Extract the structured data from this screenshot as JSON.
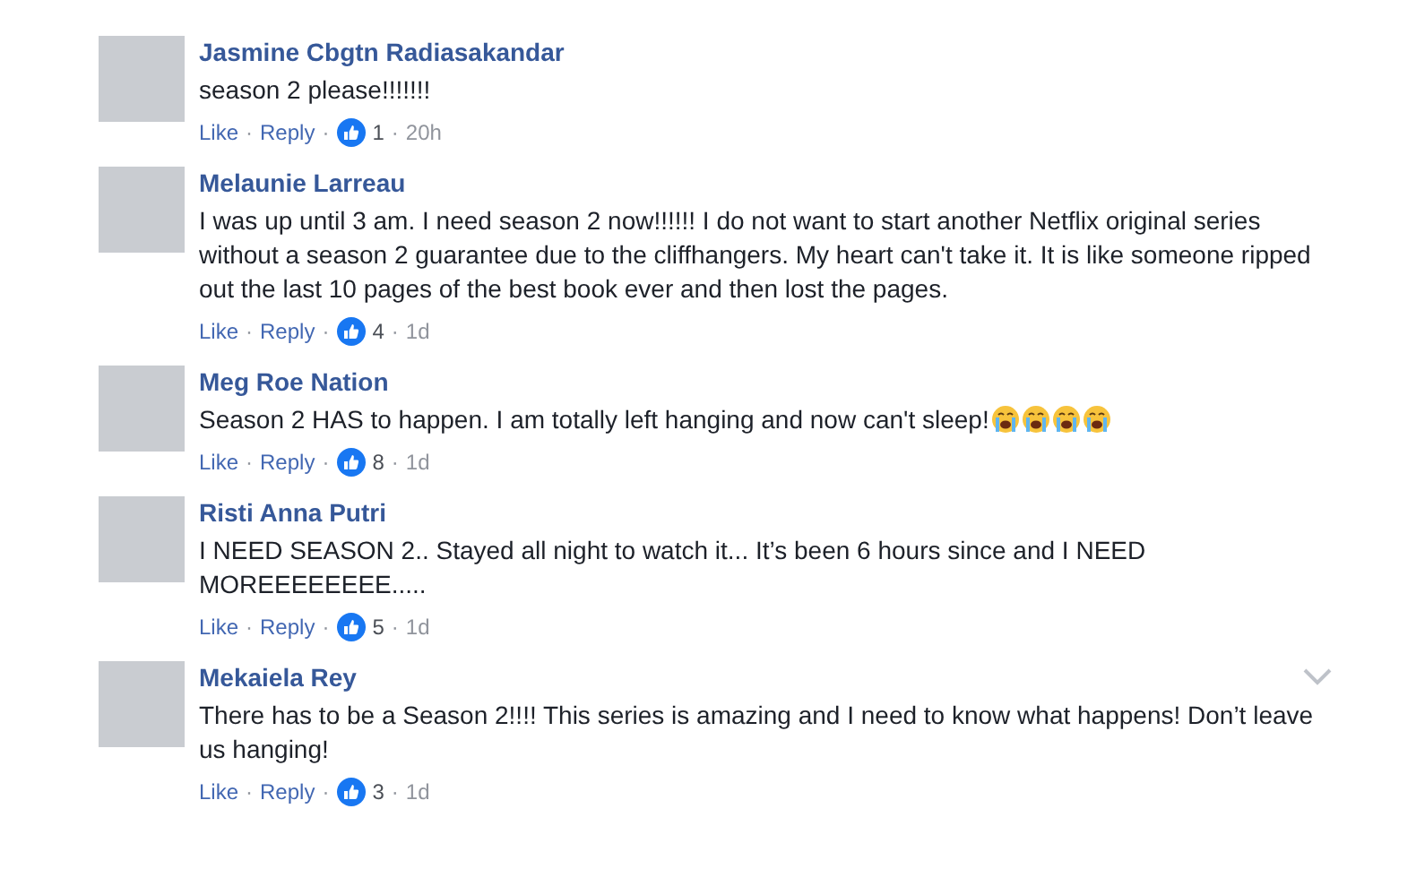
{
  "comments": [
    {
      "author": "Jasmine Cbgtn Radiasakandar",
      "text": "season 2 please!!!!!!!",
      "show_menu": false,
      "meta": [
        {
          "kind": "link",
          "text": "Like"
        },
        {
          "kind": "sep",
          "text": "·"
        },
        {
          "kind": "link",
          "text": "Reply"
        },
        {
          "kind": "sep",
          "text": "·"
        },
        {
          "kind": "likes",
          "text": "1"
        },
        {
          "kind": "sep",
          "text": "·"
        },
        {
          "kind": "time",
          "text": "20h"
        }
      ]
    },
    {
      "author": "Melaunie Larreau",
      "text": "I was up until 3 am. I need season 2 now!!!!!! I do not want to start another Netflix original series without a season 2 guarantee due to the cliffhangers. My heart can't take it. It is like someone ripped out the last 10 pages of the best book ever and then lost the pages.",
      "show_menu": false,
      "meta": [
        {
          "kind": "link",
          "text": "Like"
        },
        {
          "kind": "sep",
          "text": "·"
        },
        {
          "kind": "link",
          "text": "Reply"
        },
        {
          "kind": "sep",
          "text": "·"
        },
        {
          "kind": "likes",
          "text": "4"
        },
        {
          "kind": "sep",
          "text": "·"
        },
        {
          "kind": "time",
          "text": "1d"
        }
      ]
    },
    {
      "author": "Meg Roe Nation",
      "text": "Season 2 HAS to happen. I am totally left hanging and now can't sleep!",
      "inline_icons": [
        {
          "kind": "crying-face"
        },
        {
          "kind": "crying-face"
        },
        {
          "kind": "crying-face"
        },
        {
          "kind": "crying-face"
        }
      ],
      "show_menu": false,
      "meta": [
        {
          "kind": "link",
          "text": "Like"
        },
        {
          "kind": "sep",
          "text": "·"
        },
        {
          "kind": "link",
          "text": "Reply"
        },
        {
          "kind": "sep",
          "text": "·"
        },
        {
          "kind": "likes",
          "text": "8"
        },
        {
          "kind": "sep",
          "text": "·"
        },
        {
          "kind": "time",
          "text": "1d"
        }
      ]
    },
    {
      "author": "Risti Anna Putri",
      "text": "I NEED SEASON 2.. Stayed all night to watch it... It’s been 6 hours since and I NEED MOREEEEEEEE.....",
      "show_menu": false,
      "meta": [
        {
          "kind": "link",
          "text": "Like"
        },
        {
          "kind": "sep",
          "text": "·"
        },
        {
          "kind": "link",
          "text": "Reply"
        },
        {
          "kind": "sep",
          "text": "·"
        },
        {
          "kind": "likes",
          "text": "5"
        },
        {
          "kind": "sep",
          "text": "·"
        },
        {
          "kind": "time",
          "text": "1d"
        }
      ]
    },
    {
      "author": "Mekaiela Rey",
      "text": "There has to be a Season 2!!!! This series is amazing and I need to know what happens! Don’t leave us hanging!",
      "show_menu": true,
      "meta": [
        {
          "kind": "link",
          "text": "Like"
        },
        {
          "kind": "sep",
          "text": "·"
        },
        {
          "kind": "link",
          "text": "Reply"
        },
        {
          "kind": "sep",
          "text": "·"
        },
        {
          "kind": "likes",
          "text": "3"
        },
        {
          "kind": "sep",
          "text": "·"
        },
        {
          "kind": "time",
          "text": "1d"
        }
      ]
    }
  ]
}
